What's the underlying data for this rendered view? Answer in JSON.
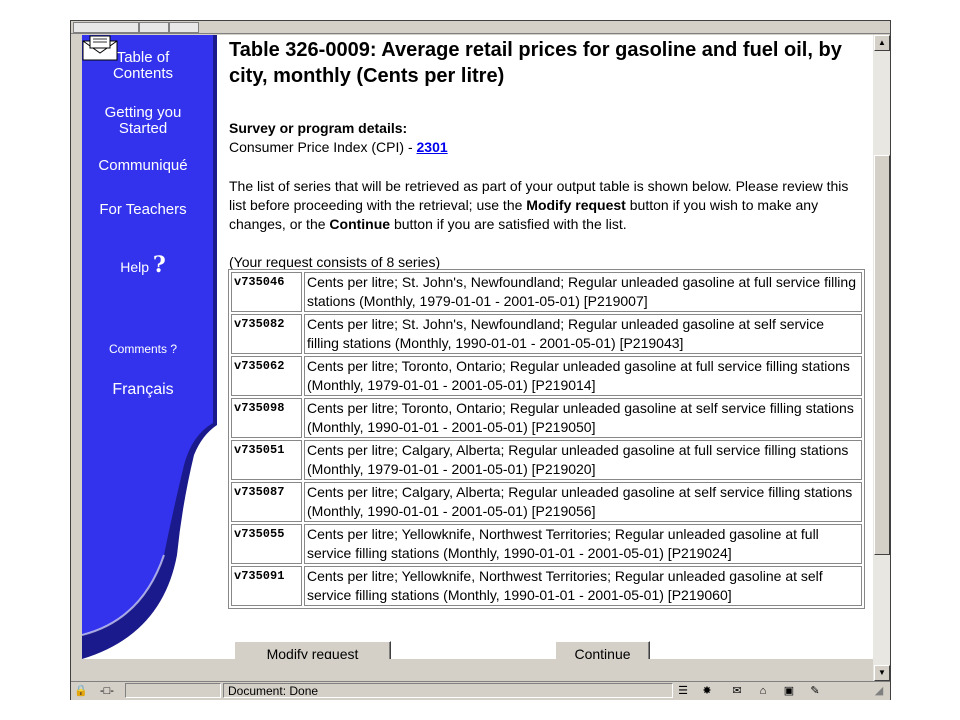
{
  "sidebar": {
    "items": [
      {
        "label_lines": [
          "Table of",
          "Contents"
        ]
      },
      {
        "label_lines": [
          "Getting you",
          "Started"
        ]
      },
      {
        "label": "Communiqué"
      },
      {
        "label": "For Teachers"
      },
      {
        "label": "Help",
        "icon": "question-mark-icon"
      },
      {
        "label": "Comments ?",
        "icon": "envelope-icon"
      },
      {
        "label": "Français"
      }
    ]
  },
  "main": {
    "title": "Table 326-0009: Average retail prices for gasoline and fuel oil, by city, monthly (Cents per litre)",
    "survey": {
      "heading": "Survey or program details:",
      "program": "Consumer Price Index (CPI) - ",
      "link": "2301"
    },
    "instructions": {
      "part1": "The list of series that will be retrieved as part of your output table is shown below. Please review this list before proceeding with the retrieval; use the ",
      "modify_bold": "Modify request",
      "part2": " button if you wish to make any changes, or the ",
      "continue_bold": "Continue",
      "part3": " button if you are satisfied with the list."
    },
    "request_summary": "(Your request consists of 8 series)",
    "series": [
      {
        "id": "v735046",
        "desc": "Cents per litre; St. John's, Newfoundland; Regular unleaded gasoline at full service filling stations (Monthly, 1979-01-01 - 2001-05-01) [P219007]"
      },
      {
        "id": "v735082",
        "desc": "Cents per litre; St. John's, Newfoundland; Regular unleaded gasoline at self service filling stations (Monthly, 1990-01-01 - 2001-05-01) [P219043]"
      },
      {
        "id": "v735062",
        "desc": "Cents per litre; Toronto, Ontario; Regular unleaded gasoline at full service filling stations (Monthly, 1979-01-01 - 2001-05-01) [P219014]"
      },
      {
        "id": "v735098",
        "desc": "Cents per litre; Toronto, Ontario; Regular unleaded gasoline at self service filling stations (Monthly, 1990-01-01 - 2001-05-01) [P219050]"
      },
      {
        "id": "v735051",
        "desc": "Cents per litre; Calgary, Alberta; Regular unleaded gasoline at full service filling stations (Monthly, 1979-01-01 - 2001-05-01) [P219020]"
      },
      {
        "id": "v735087",
        "desc": "Cents per litre; Calgary, Alberta; Regular unleaded gasoline at self service filling stations (Monthly, 1990-01-01 - 2001-05-01) [P219056]"
      },
      {
        "id": "v735055",
        "desc": "Cents per litre; Yellowknife, Northwest Territories; Regular unleaded gasoline at full service filling stations (Monthly, 1990-01-01 - 2001-05-01) [P219024]"
      },
      {
        "id": "v735091",
        "desc": "Cents per litre; Yellowknife, Northwest Territories; Regular unleaded gasoline at self service filling stations (Monthly, 1990-01-01 - 2001-05-01) [P219060]"
      }
    ],
    "buttons": {
      "modify": "Modify request",
      "continue": "Continue"
    }
  },
  "status_bar": {
    "text": "Document: Done"
  },
  "colors": {
    "sidebar_blue": "#3333ee",
    "sidebar_shadow": "#1a1a8c",
    "link": "#0000ee",
    "chrome": "#d4d0c8"
  }
}
